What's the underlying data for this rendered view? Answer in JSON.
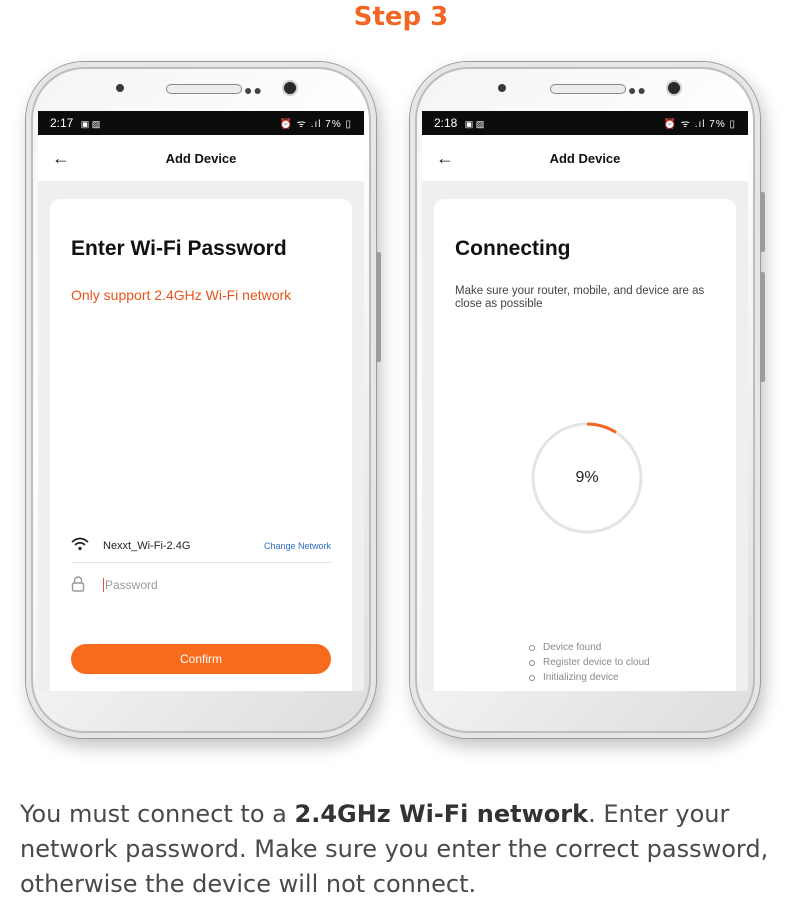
{
  "step_title": "Step 3",
  "left_phone": {
    "status": {
      "time": "2:17",
      "left_icons": "▣ ▨",
      "right_icons": "⏰ ᯤ .ıl 7% ▯"
    },
    "header": {
      "back": "←",
      "title": "Add Device"
    },
    "heading": "Enter Wi-Fi Password",
    "note": "Only support 2.4GHz Wi-Fi network",
    "wifi": {
      "icon": "wifi-icon",
      "ssid": "Nexxt_Wi-Fi-2.4G",
      "change_label": "Change Network"
    },
    "password": {
      "icon": "lock-icon",
      "placeholder": "Password"
    },
    "confirm_label": "Confirm"
  },
  "right_phone": {
    "status": {
      "time": "2:18",
      "left_icons": "▣ ▨",
      "right_icons": "⏰ ᯤ .ıl 7% ▯"
    },
    "header": {
      "back": "←",
      "title": "Add Device"
    },
    "heading": "Connecting",
    "hint": "Make sure your router, mobile, and device are as close as possible",
    "progress": {
      "percent_label": "9%",
      "fraction": 0.09
    },
    "steps": [
      "Device found",
      "Register device to cloud",
      "Initializing device"
    ]
  },
  "caption": {
    "part1": "You must connect to a ",
    "bold": "2.4GHz Wi-Fi network",
    "part2": ". Enter your network password. Make sure you enter the correct password, otherwise the device will not connect."
  },
  "colors": {
    "accent": "#f26522",
    "button": "#f76b1c",
    "link": "#2f6bbf"
  }
}
